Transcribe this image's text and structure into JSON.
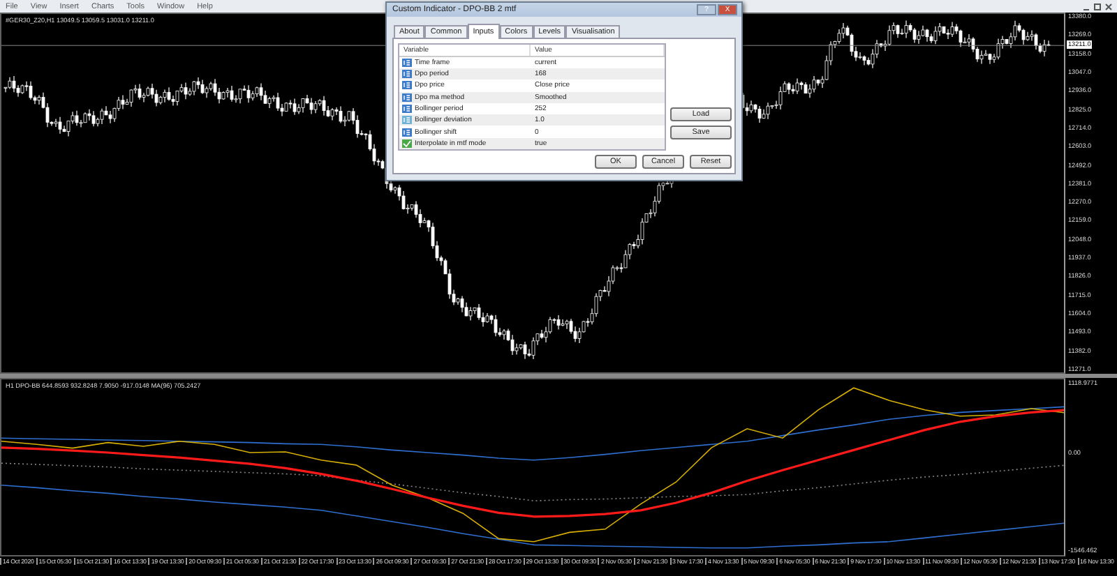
{
  "menu": [
    "File",
    "View",
    "Insert",
    "Charts",
    "Tools",
    "Window",
    "Help"
  ],
  "chart": {
    "label": "#GER30_Z20,H1 13049.5 13059.5 13031.0 13211.0",
    "current_price": "13211.0",
    "price_axis": [
      "13380.0",
      "13269.0",
      "13158.0",
      "13047.0",
      "12936.0",
      "12825.0",
      "12714.0",
      "12603.0",
      "12492.0",
      "12381.0",
      "12270.0",
      "12159.0",
      "12048.0",
      "11937.0",
      "11826.0",
      "11715.0",
      "11604.0",
      "11493.0",
      "11382.0",
      "11271.0"
    ]
  },
  "indicator": {
    "label": "H1 DPO-BB 644.8593 932.8248 7.9050 -917.0148   MA(96) 705.2427",
    "chart_data": {
      "type": "line",
      "ylim": [
        -1613.1,
        1185.6
      ],
      "yticks": [
        {
          "value": 1118.9771,
          "label": "1118.9771"
        },
        {
          "value": 0,
          "label": "0.00"
        },
        {
          "value": -1546.462,
          "label": "-1546.462"
        }
      ],
      "series": [
        {
          "color": "#2f6fd0",
          "values": [
            250,
            240,
            230,
            220,
            210,
            200,
            190,
            180,
            160,
            150,
            110,
            60,
            20,
            -20,
            -70,
            -100,
            -60,
            -10,
            50,
            100,
            150,
            200,
            290,
            380,
            460,
            550,
            610,
            660,
            690,
            720,
            750
          ]
        },
        {
          "color": "#888888",
          "line_style": "dashed",
          "values": [
            -150,
            -170,
            -190,
            -210,
            -240,
            -260,
            -280,
            -300,
            -320,
            -350,
            -420,
            -480,
            -550,
            -620,
            -680,
            -750,
            -730,
            -720,
            -700,
            -680,
            -670,
            -650,
            -590,
            -540,
            -480,
            -420,
            -370,
            -330,
            -280,
            -230,
            -180
          ]
        },
        {
          "color": "#2f6fd0",
          "values": [
            -500,
            -540,
            -590,
            -630,
            -680,
            -720,
            -770,
            -810,
            -850,
            -900,
            -990,
            -1080,
            -1170,
            -1270,
            -1360,
            -1450,
            -1460,
            -1470,
            -1480,
            -1490,
            -1500,
            -1500,
            -1470,
            -1450,
            -1420,
            -1400,
            -1340,
            -1280,
            -1220,
            -1160,
            -1100
          ]
        },
        {
          "color": "#d8b000",
          "values": [
            200,
            150,
            90,
            180,
            120,
            200,
            150,
            20,
            30,
            -100,
            -180,
            -500,
            -700,
            -950,
            -1350,
            -1400,
            -1250,
            -1200,
            -800,
            -450,
            100,
            400,
            250,
            700,
            1050,
            850,
            700,
            600,
            620,
            720,
            650
          ]
        },
        {
          "color": "#ff1a1a",
          "values": [
            100,
            80,
            50,
            20,
            -20,
            -60,
            -110,
            -160,
            -230,
            -320,
            -430,
            -560,
            -700,
            -830,
            -940,
            -1000,
            -990,
            -960,
            -900,
            -780,
            -620,
            -430,
            -260,
            -100,
            60,
            220,
            380,
            510,
            600,
            660,
            700
          ]
        }
      ]
    }
  },
  "time_axis": [
    "14 Oct 2020",
    "15 Oct 05:30",
    "15 Oct 21:30",
    "16 Oct 13:30",
    "19 Oct 13:30",
    "20 Oct 09:30",
    "21 Oct 05:30",
    "21 Oct 21:30",
    "22 Oct 17:30",
    "23 Oct 13:30",
    "26 Oct 09:30",
    "27 Oct 05:30",
    "27 Oct 21:30",
    "28 Oct 17:30",
    "29 Oct 13:30",
    "30 Oct 09:30",
    "2 Nov 05:30",
    "2 Nov 21:30",
    "3 Nov 17:30",
    "4 Nov 13:30",
    "5 Nov 09:30",
    "6 Nov 05:30",
    "6 Nov 21:30",
    "9 Nov 17:30",
    "10 Nov 13:30",
    "11 Nov 09:30",
    "12 Nov 05:30",
    "12 Nov 21:30",
    "13 Nov 17:30",
    "16 Nov 13:30"
  ],
  "dialog": {
    "title": "Custom Indicator - DPO-BB 2 mtf",
    "title_buttons": [
      "?",
      "X"
    ],
    "tabs": [
      {
        "label": "About",
        "selected": false
      },
      {
        "label": "Common",
        "selected": false
      },
      {
        "label": "Inputs",
        "selected": true
      },
      {
        "label": "Colors",
        "selected": false
      },
      {
        "label": "Levels",
        "selected": false
      },
      {
        "label": "Visualisation",
        "selected": false
      }
    ],
    "columns": [
      "Variable",
      "Value"
    ],
    "rows": [
      {
        "kind": "int",
        "variable": "Time frame",
        "value": "current"
      },
      {
        "kind": "int",
        "variable": "Dpo period",
        "value": "168"
      },
      {
        "kind": "int",
        "variable": "Dpo price",
        "value": "Close price"
      },
      {
        "kind": "int",
        "variable": "Dpo ma method",
        "value": "Smoothed"
      },
      {
        "kind": "int",
        "variable": "Bollinger period",
        "value": "252"
      },
      {
        "kind": "double",
        "variable": "Bollinger deviation",
        "value": "1.0"
      },
      {
        "kind": "int",
        "variable": "Bollinger shift",
        "value": "0"
      },
      {
        "kind": "bool",
        "variable": "Interpolate in mtf mode",
        "value": "true"
      }
    ],
    "side_buttons": [
      "Load",
      "Save"
    ],
    "buttons": [
      "OK",
      "Cancel",
      "Reset"
    ]
  }
}
